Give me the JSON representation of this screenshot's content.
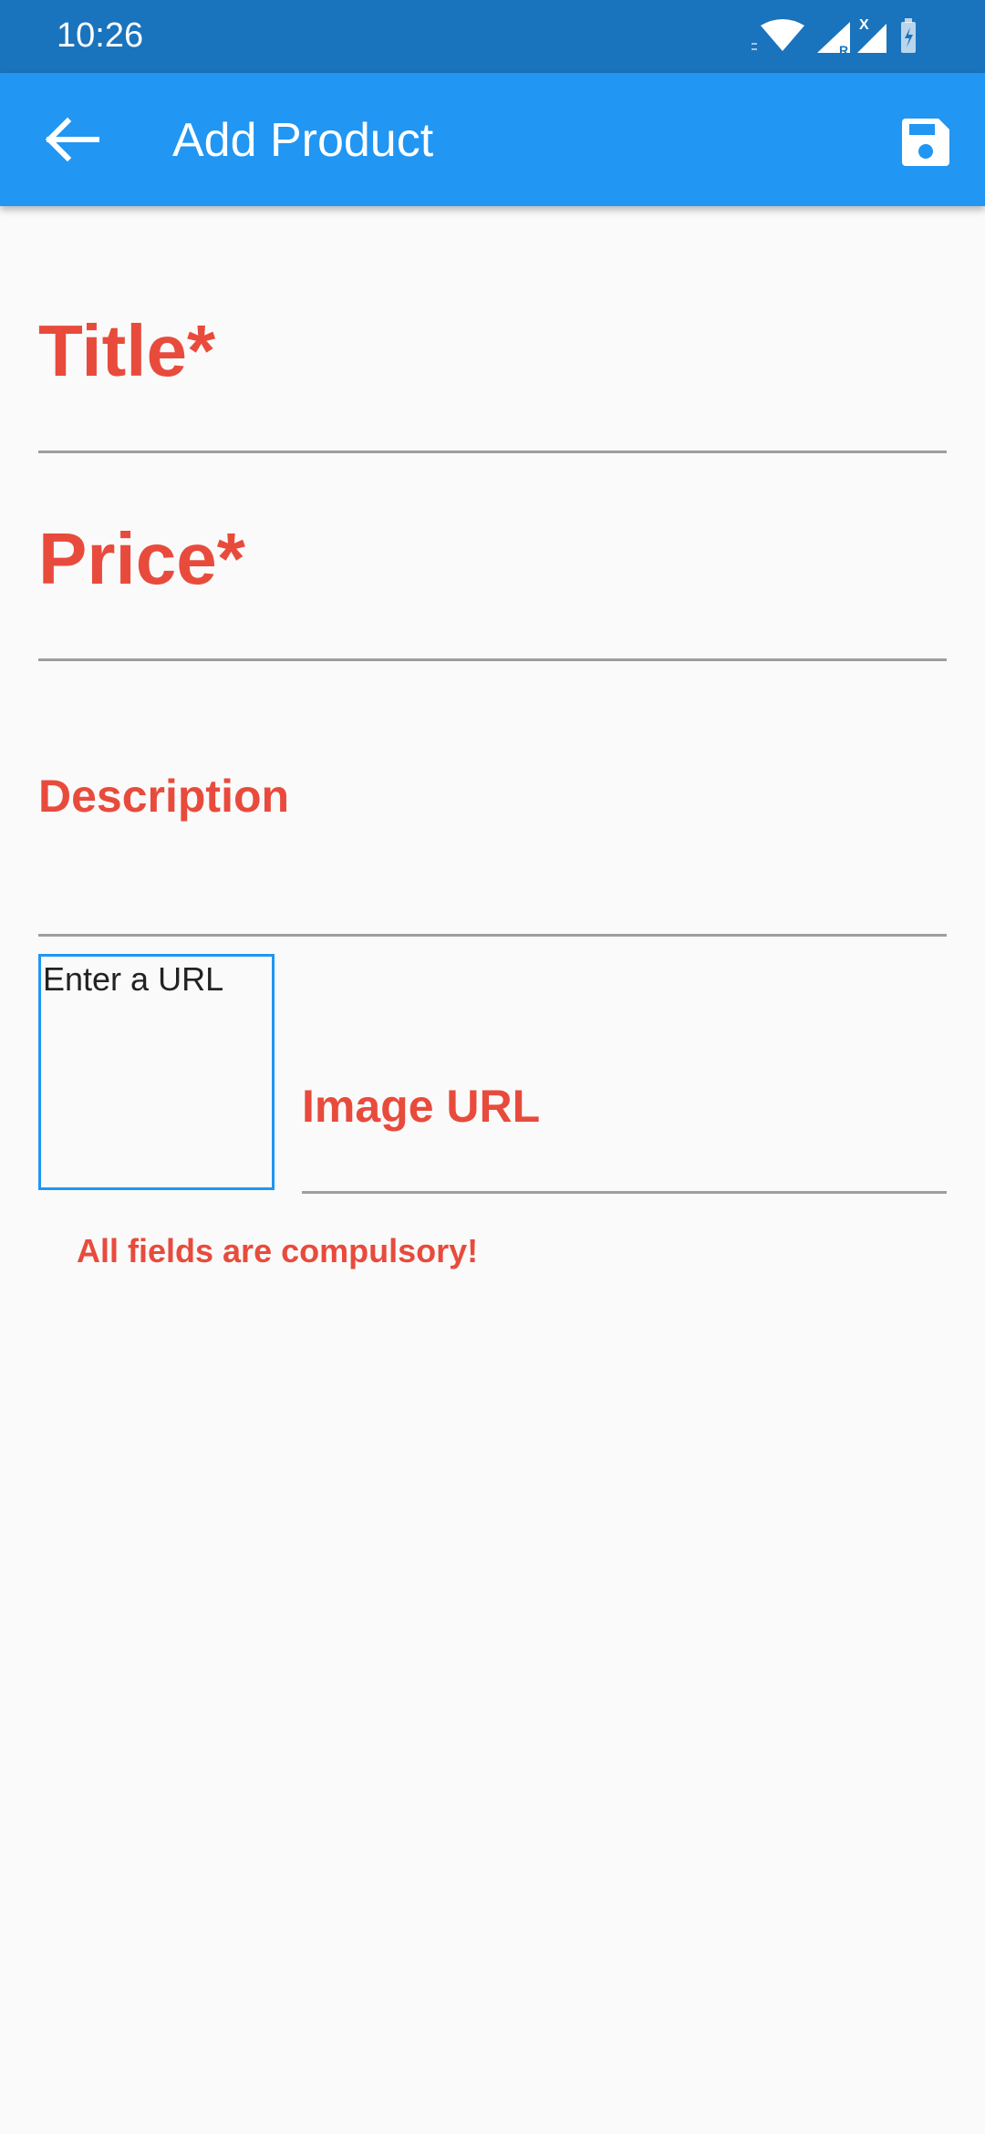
{
  "status_bar": {
    "time": "10:26",
    "icons": [
      "wifi-icon",
      "signal-roaming-icon",
      "signal-icon",
      "battery-charging-icon"
    ],
    "roaming_letter": "R",
    "sim_letter": "X"
  },
  "app_bar": {
    "title": "Add Product",
    "back_icon": "arrow-back-icon",
    "save_icon": "save-icon"
  },
  "form": {
    "title_label": "Title*",
    "price_label": "Price*",
    "description_label": "Description",
    "image_preview_text": "Enter a URL",
    "image_url_label": "Image URL",
    "error_message": "All fields are compulsory!"
  },
  "colors": {
    "primary": "#2196f3",
    "status_bar": "#1a73bd",
    "error": "#e84b3c",
    "background": "#fafafa"
  }
}
